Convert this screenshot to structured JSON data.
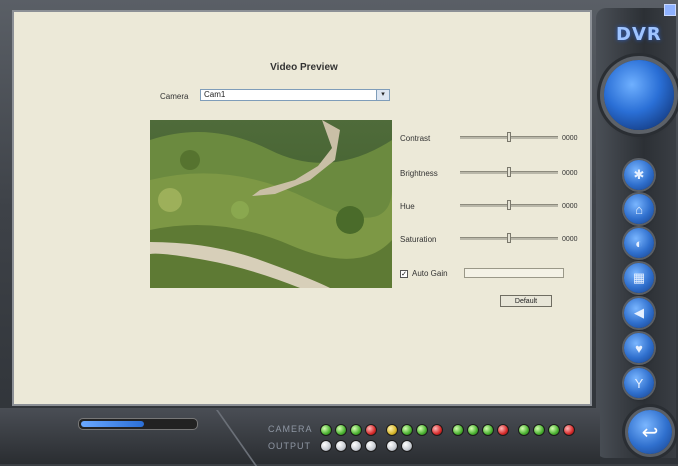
{
  "brand": {
    "logo_text": "DVR"
  },
  "panel": {
    "title": "Video Preview",
    "camera_label": "Camera",
    "camera_value": "Cam1",
    "controls": [
      {
        "label": "Contrast",
        "value": "0000",
        "level": 0.5
      },
      {
        "label": "Brightness",
        "value": "0000",
        "level": 0.5
      },
      {
        "label": "Hue",
        "value": "0000",
        "level": 0.5
      },
      {
        "label": "Saturation",
        "value": "0000",
        "level": 0.5
      }
    ],
    "auto_gain_label": "Auto Gain",
    "auto_gain_checked": true,
    "default_button": "Default"
  },
  "right_rail": {
    "big_button_text": "",
    "buttons": [
      "camera-icon",
      "settings-icon",
      "playback-icon",
      "calendar-icon",
      "audio-icon",
      "heart-icon",
      "info-icon"
    ]
  },
  "bottom_bar": {
    "row1_label": "CAMERA",
    "row2_label": "OUTPUT",
    "row1_leds": [
      "g",
      "g",
      "g",
      "r",
      "y",
      "g",
      "g",
      "r",
      "g",
      "g",
      "g",
      "r",
      "g",
      "g",
      "g",
      "r"
    ],
    "row2_leds": [
      "w",
      "w",
      "w",
      "w",
      "w",
      "w"
    ],
    "progress": 0.55
  },
  "colors": {
    "accent": "#2a6fd6",
    "panel": "#ece9d8",
    "frame": "#3e4248"
  }
}
